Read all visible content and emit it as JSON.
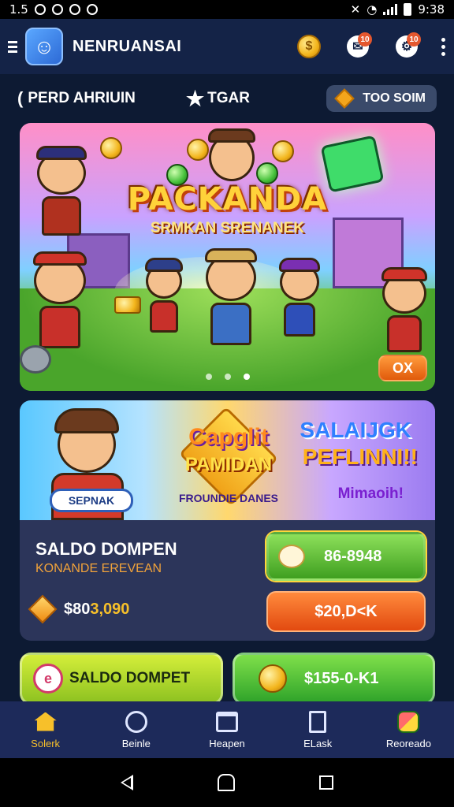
{
  "status_bar": {
    "time_left": "1.5",
    "time_right": "9:38",
    "icons": [
      "circle-icon",
      "circle-icon",
      "circle-icon",
      "circle-icon",
      "mute-icon",
      "wifi-icon",
      "signal-icon",
      "battery-icon"
    ]
  },
  "app_bar": {
    "title": "NENRUANSAI",
    "badge_mail": "10",
    "badge_settings": "10",
    "coin_symbol": "$"
  },
  "tabs": {
    "back_glyph": "(",
    "tab1": "PERD AHRIUIN",
    "tab2": "TGAR",
    "pill": "TOO SOIM"
  },
  "banner": {
    "title": "PACKANDA",
    "subtitle": "SRMKAN SRENANEK",
    "action": "OX",
    "page_dots": 3
  },
  "promo": {
    "badge": "SEPNAK",
    "mid_line1": "Capglit",
    "mid_line2": "PAMIDAN",
    "mid_line3": "FROUNDIE DANES",
    "right_line1": "SALAIJGK",
    "right_line2": "PEFLINNI!!",
    "right_line3": "Mimaoih!"
  },
  "wallet": {
    "title": "SALDO DOMPEN",
    "subtitle": "KONANDE EREVEAN",
    "amount": "$80",
    "amount_highlight": "3,090",
    "btn_green": "86-8948",
    "btn_orange": "$20,D<K"
  },
  "cards": {
    "left_icon": "e",
    "left_label": "SALDO DOMPET",
    "right_label": "$155-0-K1"
  },
  "bottom_nav": [
    {
      "label": "Solerk",
      "icon": "home-icon",
      "active": true
    },
    {
      "label": "Beinle",
      "icon": "circle-icon"
    },
    {
      "label": "Heapen",
      "icon": "calendar-icon"
    },
    {
      "label": "ELask",
      "icon": "book-icon"
    },
    {
      "label": "Reoreado",
      "icon": "puzzle-icon"
    }
  ],
  "colors": {
    "bg": "#0d1a33",
    "accent": "#f7c02a",
    "green": "#3f9f20",
    "orange": "#e24a10"
  }
}
